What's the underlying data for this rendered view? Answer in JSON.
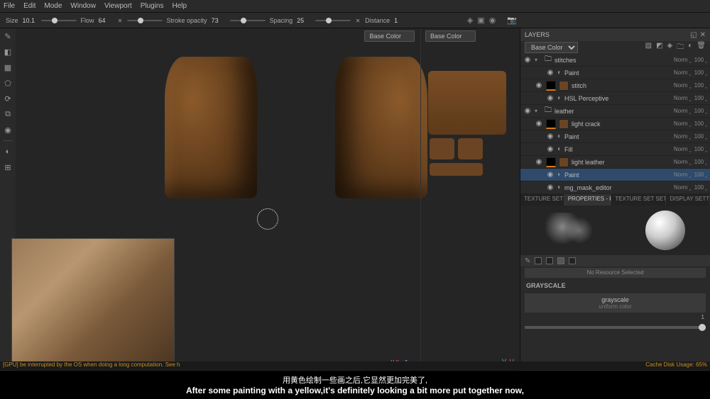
{
  "menu": [
    "File",
    "Edit",
    "Mode",
    "Window",
    "Viewport",
    "Plugins",
    "Help"
  ],
  "toolbar": {
    "size_label": "Size",
    "size_val": "10.1",
    "flow_label": "Flow",
    "flow_val": "64",
    "opacity_label": "Stroke opacity",
    "opacity_val": "73",
    "spacing_label": "Spacing",
    "spacing_val": "25",
    "distance_label": "Distance"
  },
  "viewport": {
    "mode3d": "Base Color",
    "mode2d": "Base Color",
    "axis3d_x": "x",
    "axis3d_z": "-z",
    "axis3d_y": "y",
    "axis2d_u": "U",
    "axis2d_v": "V"
  },
  "layers": {
    "title": "LAYERS",
    "channel": "Base Color",
    "norm": "Norm",
    "hundred": "100",
    "items": [
      {
        "name": "stitches",
        "type": "folder"
      },
      {
        "name": "Paint",
        "type": "effect",
        "indent": 2
      },
      {
        "name": "stitch",
        "type": "layer",
        "indent": 1
      },
      {
        "name": "HSL Perceptive",
        "type": "effect",
        "indent": 2
      },
      {
        "name": "leather",
        "type": "folder"
      },
      {
        "name": "light crack",
        "type": "layer",
        "indent": 1
      },
      {
        "name": "Paint",
        "type": "effect",
        "indent": 2
      },
      {
        "name": "Fill",
        "type": "effect",
        "indent": 2
      },
      {
        "name": "light leather",
        "type": "layer",
        "indent": 1
      },
      {
        "name": "Paint",
        "type": "effect",
        "indent": 2,
        "sel": true
      },
      {
        "name": "mg_mask_editor",
        "type": "effect",
        "indent": 2
      }
    ]
  },
  "tabs": [
    "TEXTURE SET LI…",
    "PROPERTIES - PAI…",
    "TEXTURE SET SETTIN…",
    "DISPLAY SETTIN…"
  ],
  "props": {
    "noresource": "No Resource Selected",
    "section": "GRAYSCALE",
    "gs_name": "grayscale",
    "gs_sub": "uniform color",
    "gs_val": "1"
  },
  "status": {
    "left": "[GPU]                                                                                                        be interrupted by the OS when doing a long computation. See h",
    "right": "Cache Disk Usage:    65%"
  },
  "subtitles": {
    "cn": "用黄色绘制一些画之后,它显然更加完美了,",
    "en": "After some painting with a yellow,it's definitely looking a bit more put together now,"
  }
}
